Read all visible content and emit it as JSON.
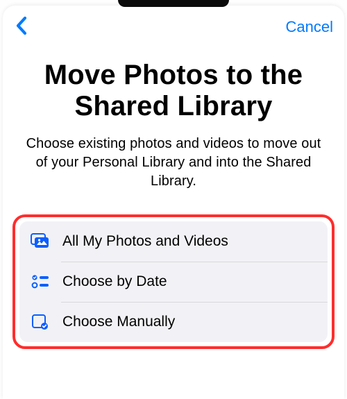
{
  "colors": {
    "accent": "#007aff",
    "icon_blue": "#0a5fff",
    "highlight_border": "#ff2d2d",
    "group_bg": "#f2f2f6"
  },
  "nav": {
    "back_icon": "chevron-left",
    "cancel_label": "Cancel"
  },
  "title": "Move Photos to the Shared Library",
  "subtitle": "Choose existing photos and videos to move out of your Personal Library and into the Shared Library.",
  "options": [
    {
      "icon": "photos-stack-icon",
      "label": "All My Photos and Videos"
    },
    {
      "icon": "choose-by-date-icon",
      "label": "Choose by Date"
    },
    {
      "icon": "choose-manually-icon",
      "label": "Choose Manually"
    }
  ]
}
